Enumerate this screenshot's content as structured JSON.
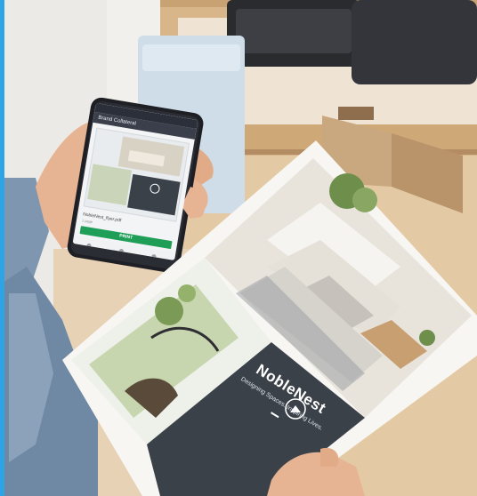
{
  "scene": {
    "palette": {
      "wall": "#f2f0ec",
      "shelf_wood": "#d9b68a",
      "shelf_shadow": "#b38c63",
      "printer": "#2a2b2e",
      "bin_blue": "#cfdde8",
      "paper": "#f7f6f3",
      "flyer_panel": "#3b4149",
      "sofa": "#e6e1d8",
      "plant_green": "#6e8f4c",
      "skin": "#e7b493",
      "shirt": "#7e96b0",
      "phone_body": "#1d1f24",
      "accent_bar": "#2ea3e6"
    }
  },
  "phone": {
    "screen_title": "Brand Collateral",
    "file_name": "NobleNest_flyer.pdf",
    "file_meta": "1 page",
    "print_label": "PRINT",
    "accent": "#1f9e57"
  },
  "flyer": {
    "brand_name": "NobleNest",
    "tagline": "Designing Spaces. Inspiring Lives."
  }
}
